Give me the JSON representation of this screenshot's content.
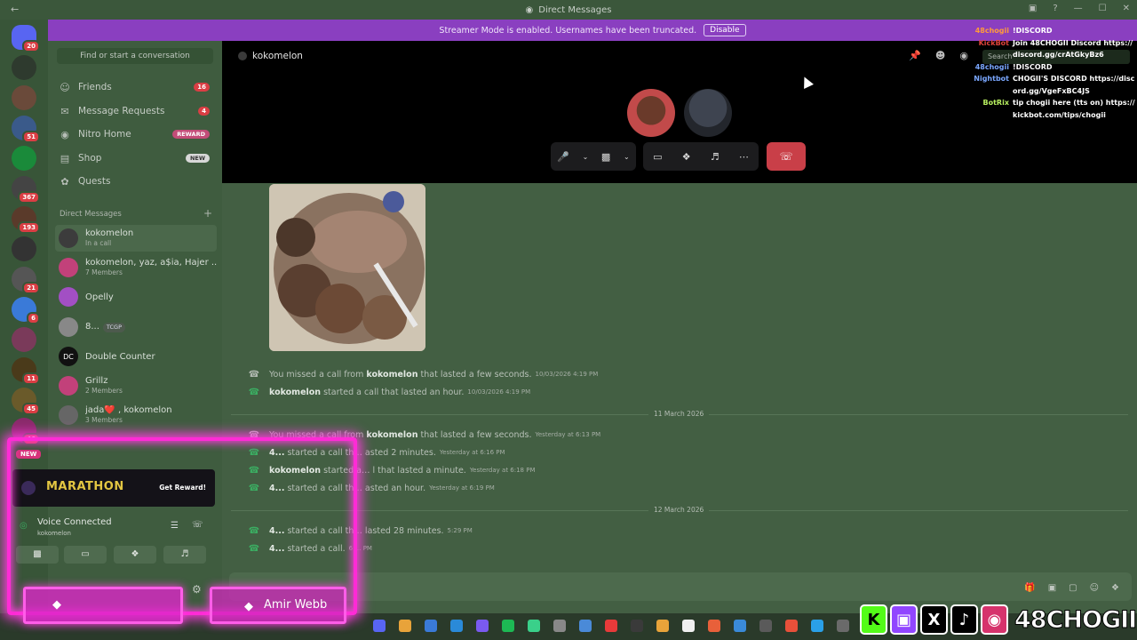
{
  "window": {
    "title": "Direct Messages",
    "back_icon": "arrow-left-icon"
  },
  "banner": {
    "text": "Streamer Mode is enabled. Usernames have been truncated.",
    "disable_label": "Disable"
  },
  "servers": [
    {
      "badge": "20"
    },
    {
      "badge": ""
    },
    {
      "badge": ""
    },
    {
      "badge": "51"
    },
    {
      "badge": ""
    },
    {
      "badge": "367"
    },
    {
      "badge": "193"
    },
    {
      "badge": ""
    },
    {
      "badge": "21"
    },
    {
      "badge": "6"
    },
    {
      "badge": ""
    },
    {
      "badge": "11"
    },
    {
      "badge": "45"
    },
    {
      "badge": "46"
    }
  ],
  "sidebar": {
    "search_placeholder": "Find or start a conversation",
    "nav": [
      {
        "label": "Friends",
        "count": "16",
        "icon": "person-wave-icon"
      },
      {
        "label": "Message Requests",
        "count": "4",
        "icon": "envelope-icon"
      },
      {
        "label": "Nitro Home",
        "tag": "REWARD",
        "icon": "nitro-icon"
      },
      {
        "label": "Shop",
        "tag": "NEW",
        "icon": "shop-icon"
      },
      {
        "label": "Quests",
        "icon": "quests-icon"
      }
    ],
    "dm_header": "Direct Messages",
    "dms": [
      {
        "name": "kokomelon",
        "sub": "In a call"
      },
      {
        "name": "kokomelon, yaz, a$ia, Hajer ...",
        "sub": "7 Members"
      },
      {
        "name": "Opelly",
        "sub": ""
      },
      {
        "name": "8...",
        "sub": "",
        "tag": "TCGP"
      },
      {
        "name": "Double Counter",
        "sub": ""
      },
      {
        "name": "Grillz",
        "sub": "2 Members"
      },
      {
        "name": "jada❤️ , kokomelon",
        "sub": "3 Members"
      }
    ]
  },
  "call": {
    "name": "kokomelon",
    "controls": [
      "mic-icon",
      "camera-off-icon",
      "share-screen-icon",
      "activities-icon",
      "soundboard-icon",
      "more-icon"
    ],
    "hangup_icon": "phone-hangup-icon"
  },
  "chat": {
    "messages": [
      {
        "pre": "You missed a call from",
        "user": "kokomelon",
        "post": "that lasted a few seconds.",
        "ts": "10/03/2026 4:19 PM",
        "missed": true
      },
      {
        "pre": "",
        "user": "kokomelon",
        "post": "started a call that lasted an hour.",
        "ts": "10/03/2026 4:19 PM",
        "missed": false
      },
      {
        "pre": "You missed a call from",
        "user": "kokomelon",
        "post": "that lasted a few seconds.",
        "ts": "Yesterday at 6:13 PM",
        "missed": true
      },
      {
        "pre": "",
        "user": "4...",
        "post": "started a call th… asted 2 minutes.",
        "ts": "Yesterday at 6:16 PM",
        "missed": false
      },
      {
        "pre": "",
        "user": "kokomelon",
        "post": "started a… l that lasted a minute.",
        "ts": "Yesterday at 6:18 PM",
        "missed": false
      },
      {
        "pre": "",
        "user": "4...",
        "post": "started a call th… asted an hour.",
        "ts": "Yesterday at 6:19 PM",
        "missed": false
      },
      {
        "pre": "",
        "user": "4...",
        "post": "started a call th… lasted 28 minutes.",
        "ts": "5:29 PM",
        "missed": false
      },
      {
        "pre": "",
        "user": "4...",
        "post": "started a call.",
        "ts": "6:… PM",
        "missed": false
      }
    ],
    "dividers": [
      "11 March 2026",
      "12 March 2026"
    ]
  },
  "overlay_chat": [
    {
      "user": "48chogii",
      "text": "!DISCORD",
      "color": "#ff9a3c"
    },
    {
      "user": "KickBot",
      "text": "Join 48CHOGII Discord https://discord.gg/crAtGkyBz6",
      "color": "#e0443a"
    },
    {
      "user": "48chogii",
      "text": "!DISCORD",
      "color": "#7aa7ff"
    },
    {
      "user": "Nightbot",
      "text": "CHOGII'S DISCORD https://discord.gg/VgeFxBC4JS",
      "color": "#7aa7ff"
    },
    {
      "user": "BotRix",
      "text": "tip chogii here (tts on) https://kickbot.com/tips/chogii",
      "color": "#b8f060"
    }
  ],
  "stream": {
    "marathon_title": "MARATHON",
    "marathon_cta": "Get Reward!",
    "new_tag": "NEW",
    "voice_title": "Voice Connected",
    "voice_sub": "kokomelon",
    "name_card": "Amir Webb",
    "brand": "48CHOGII",
    "search_placeholder": "Search"
  }
}
